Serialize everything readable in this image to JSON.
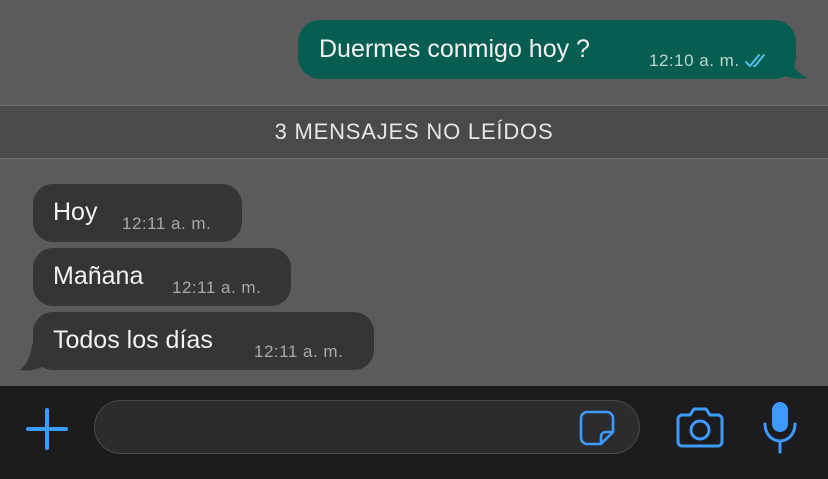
{
  "outgoing": {
    "text": "Duermes conmigo hoy ?",
    "time": "12:10 a. m.",
    "status_icon": "double-check-read-icon"
  },
  "unread_banner": {
    "label": "3 MENSAJES NO LEÍDOS"
  },
  "incoming": [
    {
      "text": "Hoy",
      "time": "12:11 a. m."
    },
    {
      "text": "Mañana",
      "time": "12:11 a. m."
    },
    {
      "text": "Todos los días",
      "time": "12:11 a. m."
    }
  ],
  "input_bar": {
    "message_value": "",
    "icons": {
      "attach": "plus-icon",
      "sticker": "sticker-icon",
      "camera": "camera-icon",
      "voice": "microphone-icon"
    }
  },
  "colors": {
    "chat_background": "#5b5b5d",
    "outgoing_bubble": "#075e50",
    "incoming_bubble": "#353537",
    "unread_banner": "#4a4a4c",
    "input_bar": "#1c1c1e",
    "accent_blue": "#3d9bff",
    "read_check": "#53bdeb"
  }
}
